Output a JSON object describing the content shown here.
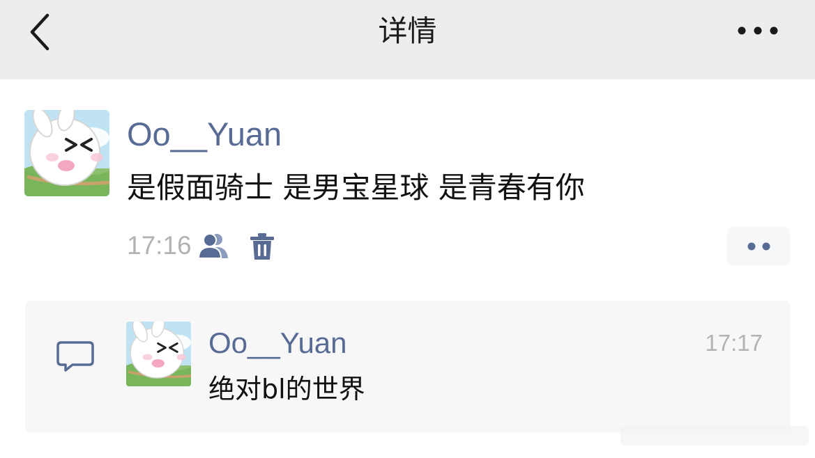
{
  "header": {
    "title": "详情",
    "back_icon": "chevron-left-icon",
    "more_icon": "more-horizontal-icon"
  },
  "post": {
    "author": "Oo__Yuan",
    "content": "是假面骑士 是男宝星球 是青春有你",
    "time": "17:16",
    "visibility_icon": "people-icon",
    "delete_icon": "trash-icon",
    "action_icon": "two-dots-icon"
  },
  "comments": {
    "section_icon": "comment-bubble-icon",
    "items": [
      {
        "author": "Oo__Yuan",
        "time": "17:17",
        "text": "绝对bl的世界"
      }
    ]
  },
  "colors": {
    "navbar_bg": "#ededed",
    "name_link": "#576b95",
    "timestamp": "#b2b2b2",
    "comment_bg": "#f7f7f7",
    "text": "#111111"
  }
}
